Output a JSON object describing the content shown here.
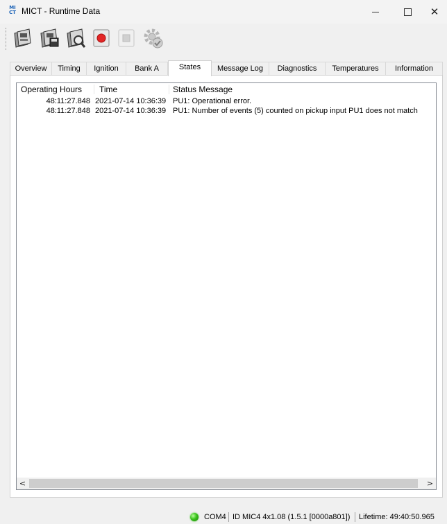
{
  "window": {
    "title": "MICT - Runtime Data",
    "logo_top": "MI",
    "logo_bottom": "CT"
  },
  "toolbar": {
    "buttons": [
      {
        "name": "read-data-icon"
      },
      {
        "name": "save-data-icon"
      },
      {
        "name": "inspect-data-icon"
      },
      {
        "name": "record-icon"
      },
      {
        "name": "stop-icon"
      },
      {
        "name": "settings-gear-icon"
      }
    ]
  },
  "tabs": [
    {
      "label": "Overview"
    },
    {
      "label": "Timing"
    },
    {
      "label": "Ignition"
    },
    {
      "label": "Bank A"
    },
    {
      "label": "States",
      "active": true
    },
    {
      "label": "Message Log"
    },
    {
      "label": "Diagnostics"
    },
    {
      "label": "Temperatures"
    },
    {
      "label": "Information"
    }
  ],
  "table": {
    "columns": [
      "Operating Hours",
      "Time",
      "Status Message"
    ],
    "rows": [
      {
        "hours": "48:11:27.848",
        "time": "2021-07-14  10:36:39",
        "message": "PU1: Operational error."
      },
      {
        "hours": "48:11:27.848",
        "time": "2021-07-14  10:36:39",
        "message": "PU1: Number of events (5) counted on pickup input PU1 does not match"
      }
    ]
  },
  "statusbar": {
    "port": "COM4",
    "device_id": "ID MIC4 4x1.08 (1.5.1 [0000a801])",
    "lifetime": "Lifetime: 49:40:50.965",
    "led_color": "#38c21a"
  }
}
